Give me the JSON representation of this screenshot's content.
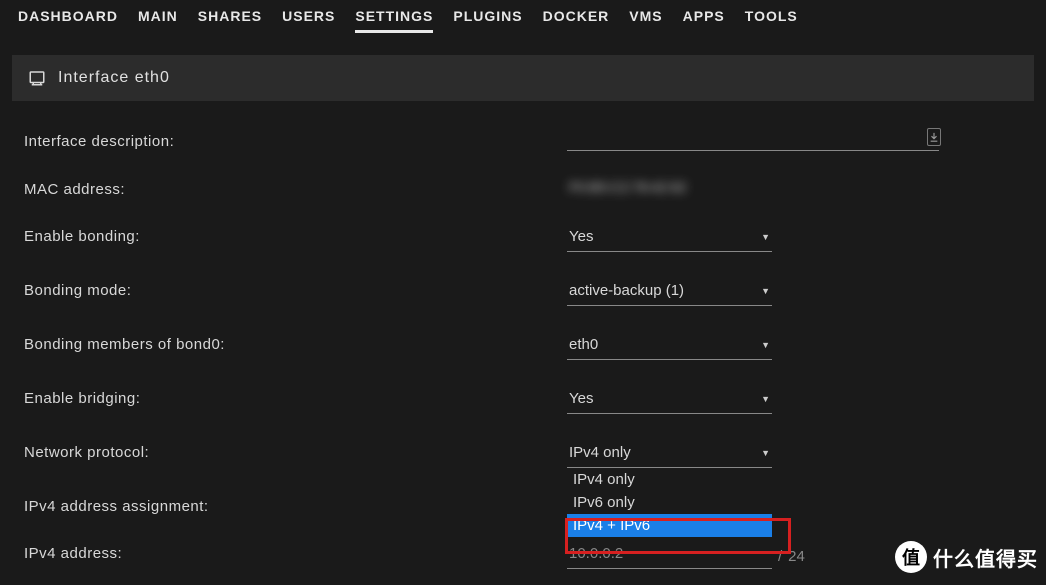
{
  "tabs": {
    "items": [
      "DASHBOARD",
      "MAIN",
      "SHARES",
      "USERS",
      "SETTINGS",
      "PLUGINS",
      "DOCKER",
      "VMS",
      "APPS",
      "TOOLS"
    ],
    "active": "SETTINGS"
  },
  "section": {
    "title": "Interface eth0"
  },
  "labels": {
    "description": "Interface description:",
    "mac": "MAC address:",
    "bonding": "Enable bonding:",
    "bonding_mode": "Bonding mode:",
    "bonding_members": "Bonding members of bond0:",
    "bridging": "Enable bridging:",
    "protocol": "Network protocol:",
    "ipv4_assign": "IPv4 address assignment:",
    "ipv4_addr": "IPv4 address:"
  },
  "values": {
    "description": "",
    "mac": "F0:B5:C2:78:42:62",
    "bonding": "Yes",
    "bonding_mode": "active-backup (1)",
    "bonding_members": "eth0",
    "bridging": "Yes",
    "protocol": "IPv4 only",
    "ipv4_addr": "10.0.0.2",
    "ipv4_mask": "24"
  },
  "protocol_options": [
    "IPv4 only",
    "IPv6 only",
    "IPv4 + IPv6"
  ],
  "watermark": {
    "symbol": "值",
    "text": "什么值得买"
  }
}
